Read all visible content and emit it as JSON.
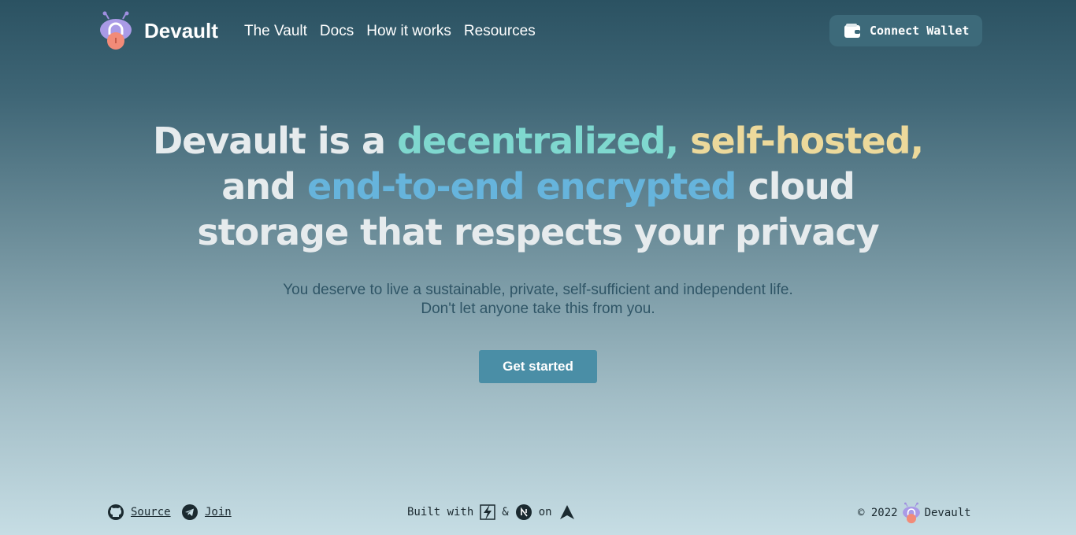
{
  "brand": {
    "name": "Devault"
  },
  "nav": {
    "items": [
      "The Vault",
      "Docs",
      "How it works",
      "Resources"
    ]
  },
  "wallet": {
    "label": "Connect Wallet"
  },
  "hero": {
    "t1": "Devault is a ",
    "t2": "decentralized,",
    "t3": " ",
    "t4": "self-hosted,",
    "t5": "and ",
    "t6": "end-to-end encrypted",
    "t7": " cloud",
    "t8": "storage that respects your privacy",
    "sub1": "You deserve to live a sustainable, private, self-sufficient and independent life.",
    "sub2": "Don't let anyone take this from you.",
    "cta": "Get started"
  },
  "footer": {
    "source": "Source",
    "join": "Join",
    "built": "Built with",
    "amp": "&",
    "on": "on",
    "copyright": "© 2022",
    "brand": "Devault"
  },
  "colors": {
    "teal": "#7fd8cf",
    "yellow": "#ecd99b",
    "blue": "#66b4dc",
    "button": "#4a8ea6"
  },
  "icons": [
    "devault-logo-icon",
    "wallet-icon",
    "github-icon",
    "telegram-icon",
    "vite-icon",
    "nextjs-icon",
    "arweave-icon"
  ]
}
